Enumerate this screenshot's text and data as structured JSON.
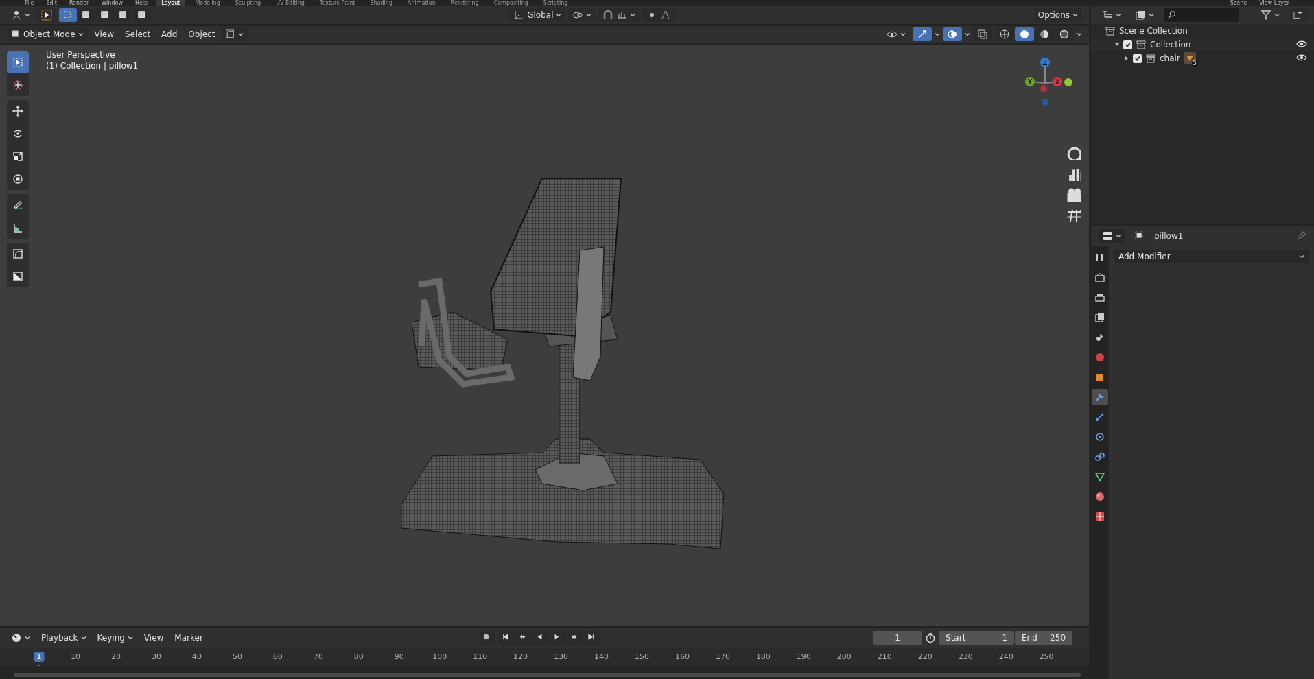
{
  "top_menu": [
    "File",
    "Edit",
    "Render",
    "Window",
    "Help"
  ],
  "workspace_tabs": [
    {
      "label": "Layout",
      "selected": true
    },
    {
      "label": "Modeling",
      "selected": false
    },
    {
      "label": "Sculpting",
      "selected": false
    },
    {
      "label": "UV Editing",
      "selected": false
    },
    {
      "label": "Texture Paint",
      "selected": false
    },
    {
      "label": "Shading",
      "selected": false
    },
    {
      "label": "Animation",
      "selected": false
    },
    {
      "label": "Rendering",
      "selected": false
    },
    {
      "label": "Compositing",
      "selected": false
    },
    {
      "label": "Scripting",
      "selected": false
    }
  ],
  "scene": "Scene",
  "view_layer": "View Layer",
  "viewport": {
    "select_modes": [
      {
        "selected": true
      },
      {
        "selected": false
      },
      {
        "selected": false
      },
      {
        "selected": false
      },
      {
        "selected": false
      }
    ],
    "orientation": "Global",
    "options": "Options",
    "mode": "Object Mode",
    "menus": [
      "View",
      "Select",
      "Add",
      "Object"
    ],
    "shading": [
      {
        "kind": "wireframe",
        "selected": false
      },
      {
        "kind": "solid",
        "selected": true
      },
      {
        "kind": "material",
        "selected": false
      },
      {
        "kind": "rendered",
        "selected": false
      }
    ],
    "overlay_text": [
      "User Perspective",
      "(1) Collection | pillow1"
    ],
    "tool_groups": [
      [
        {
          "kind": "select-box",
          "selected": true
        },
        {
          "kind": "cursor",
          "selected": false
        }
      ],
      [
        {
          "kind": "move",
          "selected": false
        },
        {
          "kind": "rotate",
          "selected": false
        },
        {
          "kind": "scale",
          "selected": false
        },
        {
          "kind": "transform",
          "selected": false
        }
      ],
      [
        {
          "kind": "annotate",
          "selected": false
        },
        {
          "kind": "measure",
          "selected": false
        }
      ],
      [
        {
          "kind": "curve",
          "selected": false
        },
        {
          "kind": "shear",
          "selected": false
        }
      ]
    ],
    "gizmo_labels": [
      "Z",
      "Y",
      "X"
    ]
  },
  "outliner": {
    "items": [
      {
        "label": "Scene Collection",
        "children": [
          {
            "label": "Collection",
            "checked": true,
            "expanded": true,
            "visible": true,
            "children": [
              {
                "label": "chair",
                "checked": true,
                "expanded": false,
                "visible": true,
                "child_count": "5"
              }
            ]
          }
        ]
      }
    ]
  },
  "properties": {
    "object": "pillow1",
    "add_modifier": "Add Modifier",
    "tabs": [
      {
        "kind": "tool",
        "selected": false
      },
      {
        "kind": "render",
        "selected": false
      },
      {
        "kind": "output",
        "selected": false
      },
      {
        "kind": "view-layer",
        "selected": false
      },
      {
        "kind": "scene",
        "selected": false
      },
      {
        "kind": "world",
        "selected": false
      },
      {
        "kind": "object",
        "selected": false
      },
      {
        "kind": "modifier",
        "selected": true
      },
      {
        "kind": "particles",
        "selected": false
      },
      {
        "kind": "physics",
        "selected": false
      },
      {
        "kind": "constraints",
        "selected": false
      },
      {
        "kind": "data",
        "selected": false
      },
      {
        "kind": "material",
        "selected": false
      },
      {
        "kind": "texture",
        "selected": false
      }
    ]
  },
  "timeline": {
    "menus": [
      {
        "label": "Playback",
        "dropdown": true
      },
      {
        "label": "Keying",
        "dropdown": true
      },
      {
        "label": "View",
        "dropdown": false
      },
      {
        "label": "Marker",
        "dropdown": false
      }
    ],
    "current_frame": "1",
    "start_label": "Start",
    "start": "1",
    "end_label": "End",
    "end": "250",
    "ticks": [
      "1",
      "10",
      "20",
      "30",
      "40",
      "50",
      "60",
      "70",
      "80",
      "90",
      "100",
      "110",
      "120",
      "130",
      "140",
      "150",
      "160",
      "170",
      "180",
      "190",
      "200",
      "210",
      "220",
      "230",
      "240",
      "250"
    ]
  }
}
